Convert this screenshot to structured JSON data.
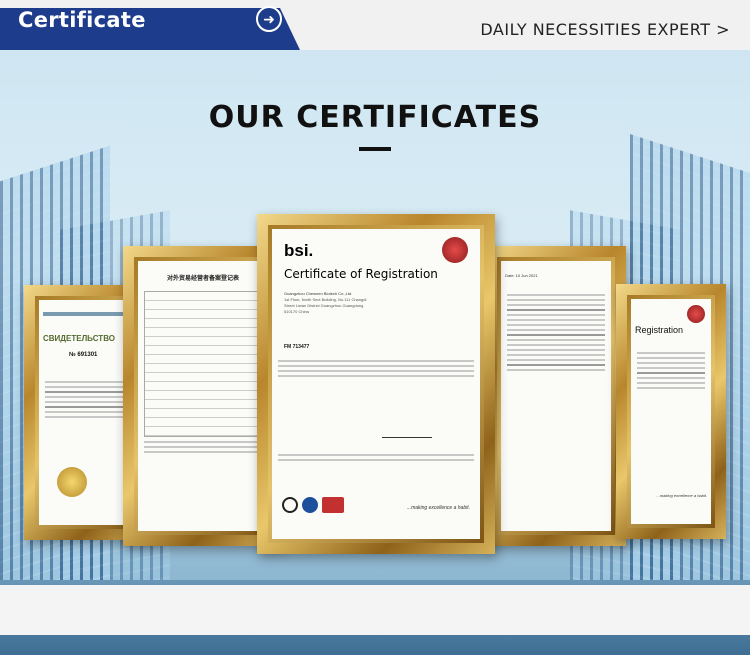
{
  "header": {
    "title": "Certificate",
    "arrow_icon": "arrow-right-circle-icon",
    "right_text": "DAILY NECESSITIES EXPERT >",
    "tab_color": "#1d3d8c"
  },
  "main": {
    "title": "OUR CERTIFICATES"
  },
  "certificates": {
    "left_far": {
      "heading": "СВИДЕТЕЛЬСТВО",
      "number": "№ 691301"
    },
    "left": {
      "heading": "对外贸易经营者备案登记表"
    },
    "center": {
      "logo": "bsi.",
      "heading": "Certificate of Registration",
      "company": "Guangzhou Chewnen Biotech Co.,Ltd.",
      "address": "1st Floor, North Sect Building, No.111 Changdi Street Liwan District Guangzhou Guangdong 510170 China",
      "cert_no": "FM 713477",
      "tagline": "...making excellence a habit."
    },
    "right": {
      "date": "Date: 10 Jun 2021"
    },
    "right_far": {
      "heading": "Registration",
      "tagline": "...making excellence a habit."
    }
  }
}
